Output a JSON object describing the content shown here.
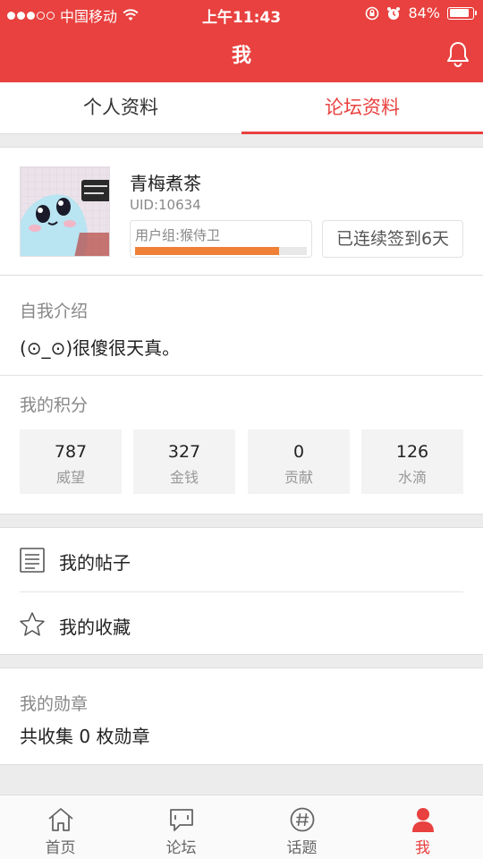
{
  "status_bar": {
    "carrier": "中国移动",
    "time": "上午11:43",
    "battery": "84%",
    "battery_level": 0.84
  },
  "nav": {
    "title": "我"
  },
  "tabs": [
    {
      "label": "个人资料",
      "active": false
    },
    {
      "label": "论坛资料",
      "active": true
    }
  ],
  "profile": {
    "username": "青梅煮茶",
    "uid": "UID:10634",
    "group": "用户组:猴侍卫",
    "group_progress": 0.84,
    "signin": "已连续签到6天"
  },
  "intro": {
    "label": "自我介绍",
    "text": "(⊙_⊙)很傻很天真。"
  },
  "points": {
    "label": "我的积分",
    "items": [
      {
        "value": "787",
        "label": "威望"
      },
      {
        "value": "327",
        "label": "金钱"
      },
      {
        "value": "0",
        "label": "贡献"
      },
      {
        "value": "126",
        "label": "水滴"
      }
    ]
  },
  "menu": [
    {
      "label": "我的帖子"
    },
    {
      "label": "我的收藏"
    }
  ],
  "medals": {
    "label": "我的勋章",
    "text": "共收集 0 枚勋章"
  },
  "tabbar": [
    {
      "label": "首页",
      "active": false
    },
    {
      "label": "论坛",
      "active": false
    },
    {
      "label": "话题",
      "active": false
    },
    {
      "label": "我",
      "active": true
    }
  ],
  "colors": {
    "accent": "#e8413f",
    "progress": "#f08036"
  }
}
